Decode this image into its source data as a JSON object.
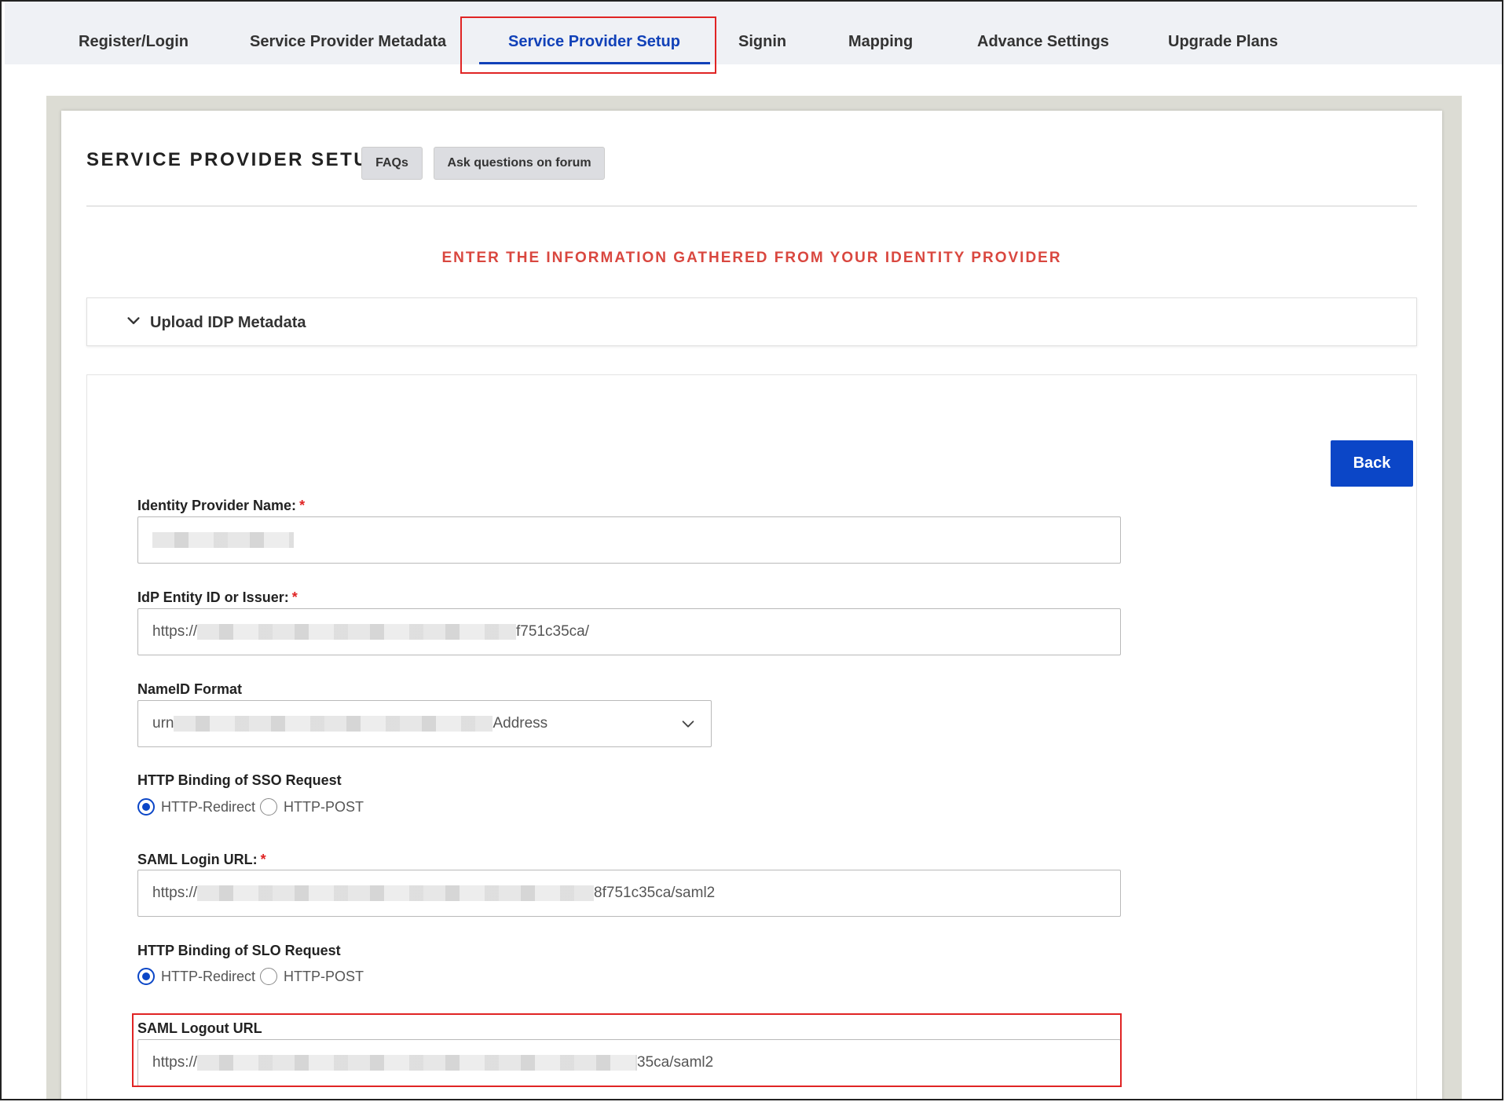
{
  "tabs": [
    {
      "label": "Register/Login"
    },
    {
      "label": "Service Provider Metadata"
    },
    {
      "label": "Service Provider Setup",
      "active": true
    },
    {
      "label": "Signin"
    },
    {
      "label": "Mapping"
    },
    {
      "label": "Advance Settings"
    },
    {
      "label": "Upgrade Plans"
    }
  ],
  "page": {
    "title": "SERVICE PROVIDER SETUP",
    "faqs_label": "FAQs",
    "forum_label": "Ask questions on forum",
    "subheading": "ENTER THE INFORMATION GATHERED FROM YOUR IDENTITY PROVIDER"
  },
  "accordion": {
    "label": "Upload IDP Metadata",
    "icon": "chevron-down-icon"
  },
  "form": {
    "back_label": "Back",
    "idp_name": {
      "label": "Identity Provider Name:",
      "required": "*",
      "value": ""
    },
    "entity_id": {
      "label": "IdP Entity ID or Issuer:",
      "required": "*",
      "prefix": "https://",
      "suffix": "f751c35ca/"
    },
    "nameid": {
      "label": "NameID Format",
      "prefix": "urn",
      "suffix": "Address"
    },
    "sso_binding": {
      "label": "HTTP Binding of SSO Request",
      "options": [
        "HTTP-Redirect",
        "HTTP-POST"
      ],
      "selected": "HTTP-Redirect"
    },
    "login_url": {
      "label": "SAML Login URL:",
      "required": "*",
      "prefix": "https://",
      "suffix": "8f751c35ca/saml2"
    },
    "slo_binding": {
      "label": "HTTP Binding of SLO Request",
      "options": [
        "HTTP-Redirect",
        "HTTP-POST"
      ],
      "selected": "HTTP-Redirect"
    },
    "logout_url": {
      "label": "SAML Logout URL",
      "prefix": "https://",
      "suffix": "35ca/saml2"
    }
  },
  "colors": {
    "accent": "#0b46c7",
    "tab_active": "#1141b8",
    "highlight": "#e02424",
    "subheading": "#d9473f"
  }
}
